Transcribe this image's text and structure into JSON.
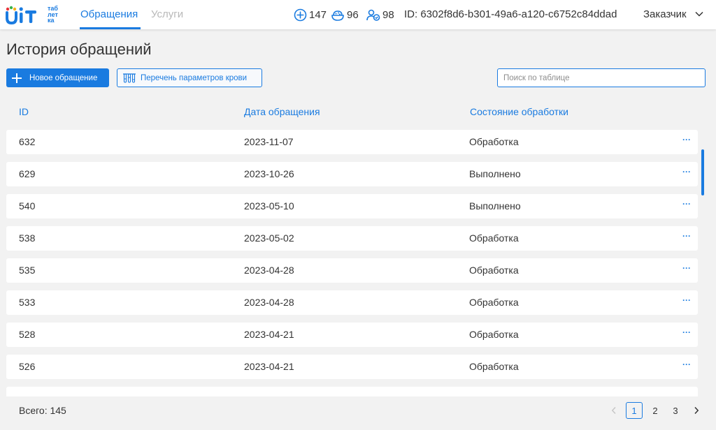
{
  "colors": {
    "accent": "#1a7be0",
    "background": "#f2f2f2",
    "logo_dot_red": "#e8333a",
    "logo_dot_green": "#36b34a",
    "logo_dot_yellow": "#f3b21b",
    "logo_dot_blue": "#1a7be0"
  },
  "logo": {
    "mark": "ᑌiT",
    "lines": [
      "таб",
      "лет",
      "ка"
    ]
  },
  "nav": {
    "tabs": [
      {
        "label": "Обращения",
        "active": true
      },
      {
        "label": "Услуги",
        "active": false
      }
    ]
  },
  "header": {
    "stats": [
      {
        "icon": "plus-circle-icon",
        "value": "147"
      },
      {
        "icon": "bowl-icon",
        "value": "96"
      },
      {
        "icon": "users-badge-icon",
        "value": "98"
      }
    ],
    "user_id": "ID: 6302f8d6-b301-49a6-a120-c6752c84ddad",
    "role": "Заказчик"
  },
  "page": {
    "title": "История обращений"
  },
  "toolbar": {
    "new_request_label": "Новое обращение",
    "params_label": "Перечень параметров крови",
    "search_placeholder": "Поиск по таблице"
  },
  "table": {
    "columns": [
      "ID",
      "Дата обращения",
      "Состояние обработки"
    ],
    "rows": [
      {
        "id": "632",
        "date": "2023-11-07",
        "status": "Обработка"
      },
      {
        "id": "629",
        "date": "2023-10-26",
        "status": "Выполнено"
      },
      {
        "id": "540",
        "date": "2023-05-10",
        "status": "Выполнено"
      },
      {
        "id": "538",
        "date": "2023-05-02",
        "status": "Обработка"
      },
      {
        "id": "535",
        "date": "2023-04-28",
        "status": "Обработка"
      },
      {
        "id": "533",
        "date": "2023-04-28",
        "status": "Обработка"
      },
      {
        "id": "528",
        "date": "2023-04-21",
        "status": "Обработка"
      },
      {
        "id": "526",
        "date": "2023-04-21",
        "status": "Обработка"
      },
      {
        "id": "",
        "date": "",
        "status": ""
      }
    ],
    "row_action": "···"
  },
  "footer": {
    "total": "Всего: 145",
    "pages": [
      "1",
      "2",
      "3"
    ],
    "current_page": "1",
    "prev": "‹",
    "next": "›"
  }
}
